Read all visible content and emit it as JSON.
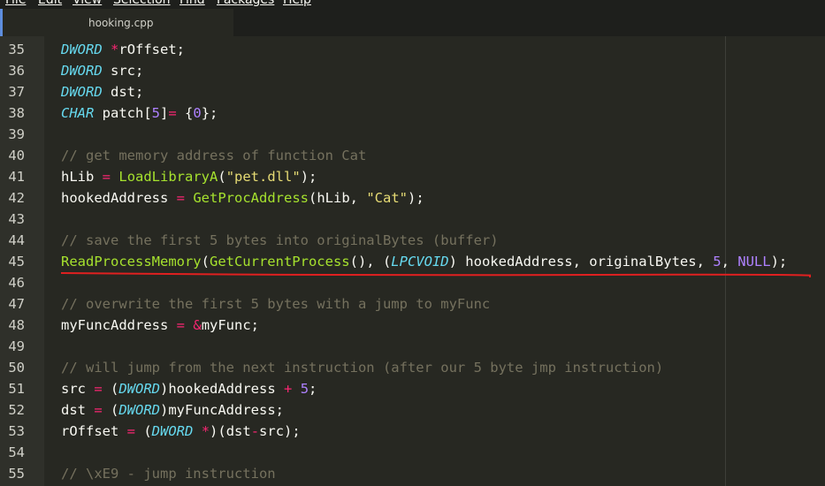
{
  "menu": {
    "items": [
      {
        "label": "File"
      },
      {
        "label": "Edit"
      },
      {
        "label": "View"
      },
      {
        "label": "Selection"
      },
      {
        "label": "Find"
      },
      {
        "label": "Packages"
      },
      {
        "label": "Help"
      }
    ]
  },
  "tab": {
    "label": "hooking.cpp"
  },
  "lines": [
    {
      "num": "35",
      "tokens": [
        {
          "t": "DWORD",
          "c": "type"
        },
        {
          "t": " ",
          "c": "txt"
        },
        {
          "t": "*",
          "c": "op"
        },
        {
          "t": "rOffset;",
          "c": "txt"
        }
      ]
    },
    {
      "num": "36",
      "tokens": [
        {
          "t": "DWORD",
          "c": "type"
        },
        {
          "t": " src;",
          "c": "txt"
        }
      ]
    },
    {
      "num": "37",
      "tokens": [
        {
          "t": "DWORD",
          "c": "type"
        },
        {
          "t": " dst;",
          "c": "txt"
        }
      ]
    },
    {
      "num": "38",
      "tokens": [
        {
          "t": "CHAR",
          "c": "type"
        },
        {
          "t": " patch[",
          "c": "txt"
        },
        {
          "t": "5",
          "c": "num"
        },
        {
          "t": "]",
          "c": "txt"
        },
        {
          "t": "=",
          "c": "op"
        },
        {
          "t": " {",
          "c": "txt"
        },
        {
          "t": "0",
          "c": "num"
        },
        {
          "t": "};",
          "c": "txt"
        }
      ]
    },
    {
      "num": "39",
      "tokens": []
    },
    {
      "num": "40",
      "tokens": [
        {
          "t": "// get memory address of function Cat",
          "c": "cm"
        }
      ]
    },
    {
      "num": "41",
      "tokens": [
        {
          "t": "hLib ",
          "c": "txt"
        },
        {
          "t": "=",
          "c": "op"
        },
        {
          "t": " ",
          "c": "txt"
        },
        {
          "t": "LoadLibraryA",
          "c": "fn"
        },
        {
          "t": "(",
          "c": "txt"
        },
        {
          "t": "\"pet.dll\"",
          "c": "str"
        },
        {
          "t": ");",
          "c": "txt"
        }
      ]
    },
    {
      "num": "42",
      "tokens": [
        {
          "t": "hookedAddress ",
          "c": "txt"
        },
        {
          "t": "=",
          "c": "op"
        },
        {
          "t": " ",
          "c": "txt"
        },
        {
          "t": "GetProcAddress",
          "c": "fn"
        },
        {
          "t": "(hLib, ",
          "c": "txt"
        },
        {
          "t": "\"Cat\"",
          "c": "str"
        },
        {
          "t": ");",
          "c": "txt"
        }
      ]
    },
    {
      "num": "43",
      "tokens": []
    },
    {
      "num": "44",
      "tokens": [
        {
          "t": "// save the first 5 bytes into originalBytes (buffer)",
          "c": "cm"
        }
      ]
    },
    {
      "num": "45",
      "tokens": [
        {
          "t": "ReadProcessMemory",
          "c": "fn"
        },
        {
          "t": "(",
          "c": "txt"
        },
        {
          "t": "GetCurrentProcess",
          "c": "fn"
        },
        {
          "t": "(), (",
          "c": "txt"
        },
        {
          "t": "LPCVOID",
          "c": "type"
        },
        {
          "t": ") hookedAddress, originalBytes, ",
          "c": "txt"
        },
        {
          "t": "5",
          "c": "num"
        },
        {
          "t": ", ",
          "c": "txt"
        },
        {
          "t": "NULL",
          "c": "num"
        },
        {
          "t": ");",
          "c": "txt"
        }
      ]
    },
    {
      "num": "46",
      "tokens": []
    },
    {
      "num": "47",
      "tokens": [
        {
          "t": "// overwrite the first 5 bytes with a jump to myFunc",
          "c": "cm"
        }
      ]
    },
    {
      "num": "48",
      "tokens": [
        {
          "t": "myFuncAddress ",
          "c": "txt"
        },
        {
          "t": "=",
          "c": "op"
        },
        {
          "t": " ",
          "c": "txt"
        },
        {
          "t": "&",
          "c": "op"
        },
        {
          "t": "myFunc;",
          "c": "txt"
        }
      ]
    },
    {
      "num": "49",
      "tokens": []
    },
    {
      "num": "50",
      "tokens": [
        {
          "t": "// will jump from the next instruction (after our 5 byte jmp instruction)",
          "c": "cm"
        }
      ]
    },
    {
      "num": "51",
      "tokens": [
        {
          "t": "src ",
          "c": "txt"
        },
        {
          "t": "=",
          "c": "op"
        },
        {
          "t": " (",
          "c": "txt"
        },
        {
          "t": "DWORD",
          "c": "type"
        },
        {
          "t": ")hookedAddress ",
          "c": "txt"
        },
        {
          "t": "+",
          "c": "op"
        },
        {
          "t": " ",
          "c": "txt"
        },
        {
          "t": "5",
          "c": "num"
        },
        {
          "t": ";",
          "c": "txt"
        }
      ]
    },
    {
      "num": "52",
      "tokens": [
        {
          "t": "dst ",
          "c": "txt"
        },
        {
          "t": "=",
          "c": "op"
        },
        {
          "t": " (",
          "c": "txt"
        },
        {
          "t": "DWORD",
          "c": "type"
        },
        {
          "t": ")myFuncAddress;",
          "c": "txt"
        }
      ]
    },
    {
      "num": "53",
      "tokens": [
        {
          "t": "rOffset ",
          "c": "txt"
        },
        {
          "t": "=",
          "c": "op"
        },
        {
          "t": " (",
          "c": "txt"
        },
        {
          "t": "DWORD",
          "c": "type"
        },
        {
          "t": " ",
          "c": "txt"
        },
        {
          "t": "*",
          "c": "op"
        },
        {
          "t": ")(dst",
          "c": "txt"
        },
        {
          "t": "-",
          "c": "op"
        },
        {
          "t": "src);",
          "c": "txt"
        }
      ]
    },
    {
      "num": "54",
      "tokens": []
    },
    {
      "num": "55",
      "tokens": [
        {
          "t": "// \\xE9 - jump instruction",
          "c": "cm"
        }
      ]
    }
  ],
  "colors": {
    "background": "#272822",
    "gutter": "#2f302a",
    "tab_accent": "#5e8ede",
    "annotation": "#e02020"
  }
}
